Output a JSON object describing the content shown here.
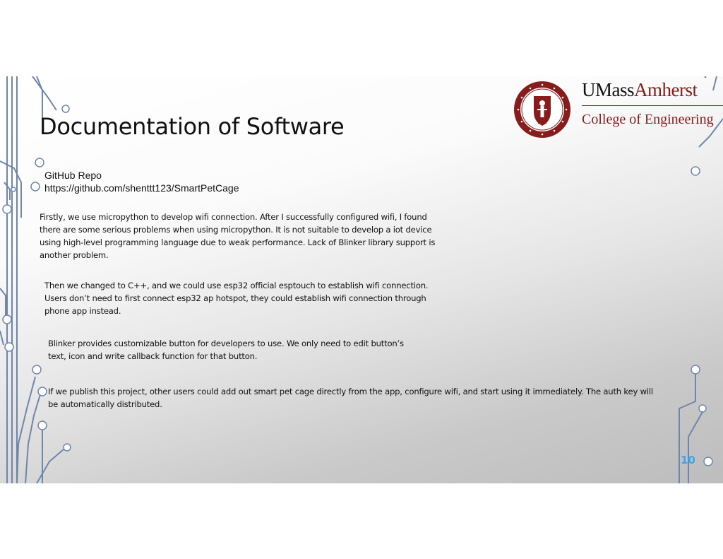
{
  "slide": {
    "title": "Documentation of Software",
    "brand": {
      "name_part1": "UMass",
      "name_part2": "Amherst",
      "college": "College of Engineering"
    },
    "repo": {
      "label": "GitHub Repo",
      "url": "https://github.com/shenttt123/SmartPetCage"
    },
    "paragraphs": [
      "Firstly, we use micropython to develop wifi connection. After I successfully configured wifi, I found there are some serious problems when using micropython. It is not suitable to develop a iot device using high-level programming language due to weak performance. Lack of Blinker library support is another problem.",
      "Then we changed to C++, and we could use esp32 official esptouch to establish wifi connection. Users don’t need to first connect esp32 ap hotspot, they could establish wifi connection through phone app instead.",
      "Blinker provides customizable button for developers to use. We only need to edit button’s text, icon and write callback function for that button.",
      "If we publish this project, other users could add out smart pet cage directly from the app, configure wifi, and start using it immediately. The auth key will be automatically distributed."
    ],
    "page_number": "10",
    "colors": {
      "brand_maroon": "#881c1c",
      "page_number": "#3aa6ea",
      "circuit_lines": "#6f86ac"
    }
  }
}
